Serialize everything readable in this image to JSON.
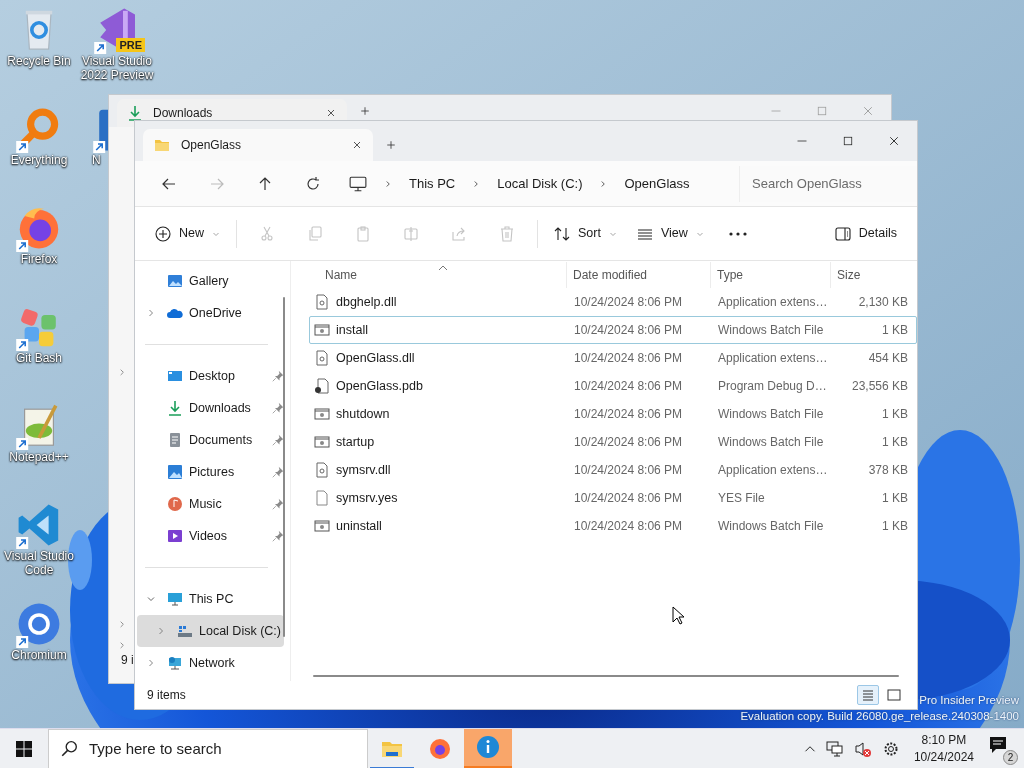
{
  "desktop": {
    "column_1": [
      {
        "label": "Recycle Bin",
        "kind": "recycle",
        "shortcut": false
      },
      {
        "label": "Everything",
        "kind": "everything",
        "shortcut": true
      },
      {
        "label": "Firefox",
        "kind": "firefox",
        "shortcut": true
      },
      {
        "label": "Git Bash",
        "kind": "gitbash",
        "shortcut": true
      },
      {
        "label": "Notepad++",
        "kind": "notepad",
        "shortcut": true
      },
      {
        "label": "Visual Studio Code",
        "kind": "vscode",
        "shortcut": true
      },
      {
        "label": "Chromium",
        "kind": "chromium",
        "shortcut": true
      }
    ],
    "column_2": [
      {
        "label": "Visual Studio 2022 Preview",
        "kind": "vs",
        "shortcut": true,
        "badge": "PRE"
      },
      {
        "label": "N",
        "kind": "app",
        "shortcut": true
      }
    ],
    "build_info": [
      "Pro Insider Preview",
      "Evaluation copy. Build 26080.ge_release.240308-1400"
    ]
  },
  "back_window": {
    "tab": "Downloads",
    "status": "9 i"
  },
  "window": {
    "tab": "OpenGlass",
    "nav_buttons": [
      {
        "kind": "back",
        "disabled": false
      },
      {
        "kind": "forward",
        "disabled": true
      },
      {
        "kind": "up",
        "disabled": false
      },
      {
        "kind": "refresh",
        "disabled": false
      }
    ],
    "breadcrumb": [
      "This PC",
      "Local Disk (C:)",
      "OpenGlass"
    ],
    "search": {
      "placeholder": "Search OpenGlass"
    },
    "toolbar": [
      {
        "kind": "new",
        "label": "New",
        "dropdown": true,
        "disabled": false
      },
      {
        "kind": "cut",
        "disabled": true
      },
      {
        "kind": "copy",
        "disabled": true
      },
      {
        "kind": "paste",
        "disabled": true
      },
      {
        "kind": "rename",
        "disabled": true
      },
      {
        "kind": "share",
        "disabled": true
      },
      {
        "kind": "delete",
        "disabled": true
      },
      {
        "kind": "sort",
        "label": "Sort",
        "dropdown": true,
        "disabled": false
      },
      {
        "kind": "view",
        "label": "View",
        "dropdown": true,
        "disabled": false
      },
      {
        "kind": "more",
        "disabled": false
      },
      {
        "kind": "details",
        "label": "Details",
        "disabled": false
      }
    ],
    "sidebar": [
      [
        {
          "label": "Gallery",
          "kind": "gallery",
          "selected": false
        },
        {
          "label": "OneDrive",
          "kind": "onedrive",
          "expanded": false,
          "selected": false
        }
      ],
      [
        {
          "label": "Desktop",
          "kind": "desktop",
          "pinned": true,
          "selected": false
        },
        {
          "label": "Downloads",
          "kind": "downloads",
          "pinned": true,
          "selected": false
        },
        {
          "label": "Documents",
          "kind": "documents",
          "pinned": true,
          "selected": false
        },
        {
          "label": "Pictures",
          "kind": "pictures",
          "pinned": true,
          "selected": false
        },
        {
          "label": "Music",
          "kind": "music",
          "pinned": true,
          "selected": false
        },
        {
          "label": "Videos",
          "kind": "videos",
          "pinned": true,
          "selected": false
        }
      ],
      [
        {
          "label": "This PC",
          "kind": "thispc",
          "expanded": true,
          "selected": false,
          "children": [
            {
              "label": "Local Disk (C:)",
              "kind": "disk",
              "expanded": false,
              "selected": true
            }
          ]
        },
        {
          "label": "Network",
          "kind": "network",
          "expanded": false,
          "selected": false
        }
      ]
    ],
    "columns": [
      {
        "label": "Name",
        "sorted": true
      },
      {
        "label": "Date modified",
        "sorted": false
      },
      {
        "label": "Type",
        "sorted": false
      },
      {
        "label": "Size",
        "sorted": false
      }
    ],
    "files": [
      {
        "name": "dbghelp.dll",
        "date": "10/24/2024 8:06 PM",
        "type": "Application extens…",
        "size": "2,130 KB",
        "kind": "dll",
        "focused": false
      },
      {
        "name": "install",
        "date": "10/24/2024 8:06 PM",
        "type": "Windows Batch File",
        "size": "1 KB",
        "kind": "bat",
        "focused": true
      },
      {
        "name": "OpenGlass.dll",
        "date": "10/24/2024 8:06 PM",
        "type": "Application extens…",
        "size": "454 KB",
        "kind": "dll",
        "focused": false
      },
      {
        "name": "OpenGlass.pdb",
        "date": "10/24/2024 8:06 PM",
        "type": "Program Debug D…",
        "size": "23,556 KB",
        "kind": "pdb",
        "focused": false
      },
      {
        "name": "shutdown",
        "date": "10/24/2024 8:06 PM",
        "type": "Windows Batch File",
        "size": "1 KB",
        "kind": "bat",
        "focused": false
      },
      {
        "name": "startup",
        "date": "10/24/2024 8:06 PM",
        "type": "Windows Batch File",
        "size": "1 KB",
        "kind": "bat",
        "focused": false
      },
      {
        "name": "symsrv.dll",
        "date": "10/24/2024 8:06 PM",
        "type": "Application extens…",
        "size": "378 KB",
        "kind": "dll",
        "focused": false
      },
      {
        "name": "symsrv.yes",
        "date": "10/24/2024 8:06 PM",
        "type": "YES File",
        "size": "1 KB",
        "kind": "file",
        "focused": false
      },
      {
        "name": "uninstall",
        "date": "10/24/2024 8:06 PM",
        "type": "Windows Batch File",
        "size": "1 KB",
        "kind": "bat",
        "focused": false
      }
    ],
    "status": "9 items",
    "view_buttons": [
      {
        "kind": "details",
        "selected": true
      },
      {
        "kind": "tiles",
        "selected": false
      }
    ]
  },
  "taskbar": {
    "search": {
      "placeholder": "Type here to search"
    },
    "apps": [
      {
        "kind": "explorer",
        "active": true,
        "flashing": false
      },
      {
        "kind": "firefox",
        "active": false,
        "flashing": false
      },
      {
        "kind": "info",
        "active": false,
        "flashing": true
      }
    ],
    "volume_muted": true,
    "time": "8:10 PM",
    "date": "10/24/2024",
    "notifications": "2"
  }
}
